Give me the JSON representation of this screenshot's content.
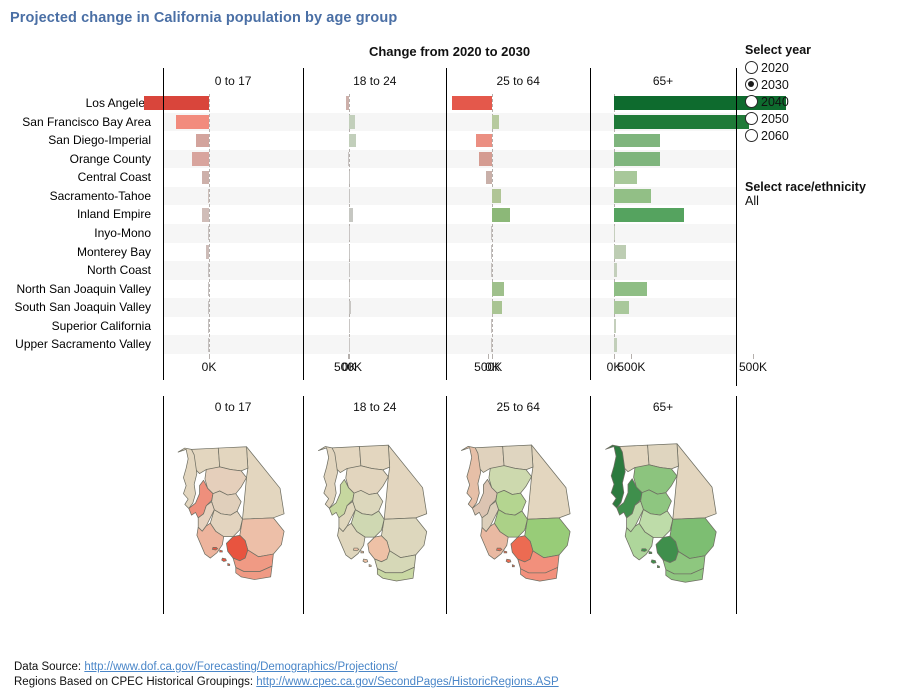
{
  "title": "Projected change in California population by age group",
  "subtitle": "Change from 2020 to 2030",
  "age_groups": [
    "0 to 17",
    "18 to 24",
    "25 to 64",
    "65+"
  ],
  "regions": [
    "Los Angeles",
    "San Francisco Bay Area",
    "San Diego-Imperial",
    "Orange County",
    "Central Coast",
    "Sacramento-Tahoe",
    "Inland Empire",
    "Inyo-Mono",
    "Monterey Bay",
    "North Coast",
    "North San Joaquin Valley",
    "South San Joaquin Valley",
    "Superior California",
    "Upper Sacramento Valley"
  ],
  "axis": {
    "ticks": [
      {
        "value": 0,
        "label": "0K"
      },
      {
        "value": 500000,
        "label": "500K"
      }
    ],
    "min": -250000,
    "max": 640000
  },
  "legend": {
    "year_title": "Select year",
    "years": [
      "2020",
      "2030",
      "2040",
      "2050",
      "2060"
    ],
    "selected_year": "2030",
    "race_title": "Select race/ethnicity",
    "race_value": "All"
  },
  "footer": {
    "line1_label": "Data Source:",
    "line1_link": "http://www.dof.ca.gov/Forecasting/Demographics/Projections/",
    "line2_label": "Regions Based on CPEC Historical Groupings:",
    "line2_link": "http://www.cpec.ca.gov/SecondPages/HistoricRegions.ASP"
  },
  "colors": {
    "title": "#4a6fa5",
    "link": "#4a86c8",
    "stripe": "#f6f6f6",
    "zero_line": "#b5b0ad",
    "neg_strong": "#d9453b",
    "neg_mid": "#f28b7d",
    "neg_weak": "#d9a9a1",
    "neg_faint": "#cdb4b0",
    "pos_strong": "#0e6b2e",
    "pos_dark": "#1f7a38",
    "pos_mid": "#55a35f",
    "pos_soft": "#7fb57d",
    "pos_weak": "#a8c89a",
    "pos_faint": "#c2cfbb",
    "map_neutral": "#e3d6bf",
    "map_outline": "#6f6f63"
  },
  "chart_data": {
    "type": "bar",
    "title": "Change from 2020 to 2030",
    "xlabel": "",
    "ylabel": "",
    "xlim": [
      -250000,
      640000
    ],
    "grid": false,
    "legend_position": "right",
    "categories": [
      "Los Angeles",
      "San Francisco Bay Area",
      "San Diego-Imperial",
      "Orange County",
      "Central Coast",
      "Sacramento-Tahoe",
      "Inland Empire",
      "Inyo-Mono",
      "Monterey Bay",
      "North Coast",
      "North San Joaquin Valley",
      "South San Joaquin Valley",
      "Superior California",
      "Upper Sacramento Valley"
    ],
    "series": [
      {
        "name": "0 to 17",
        "values": [
          -233000,
          -120000,
          -48000,
          -62000,
          -26000,
          -3000,
          -26000,
          -1000,
          -11000,
          -1500,
          -2500,
          -1000,
          -1500,
          -1000
        ],
        "colors": [
          "#d9453b",
          "#f28b7d",
          "#d3a49d",
          "#d8a49d",
          "#cdb0aa",
          "#cfc2bd",
          "#d0bdb8",
          "#c9c2c0",
          "#cdbcb8",
          "#c7c2c1",
          "#c8c3c2",
          "#c6c2c1",
          "#c6c2c1",
          "#c6c2c1"
        ]
      },
      {
        "name": "18 to 24",
        "values": [
          -13000,
          22000,
          23000,
          -1000,
          2000,
          2500,
          12000,
          200,
          1200,
          900,
          4500,
          7500,
          1500,
          600
        ],
        "colors": [
          "#cdb0aa",
          "#c2cfbb",
          "#c2cfbb",
          "#c9c4c3",
          "#c7c5c3",
          "#c7c5c3",
          "#c6c7c2",
          "#c9c5c4",
          "#c8c6c4",
          "#c8c6c4",
          "#c9c6c3",
          "#c8c6c3",
          "#c9c6c4",
          "#c9c6c4"
        ]
      },
      {
        "name": "25 to 64",
        "values": [
          -145000,
          24000,
          -59000,
          -49000,
          -22000,
          31000,
          65000,
          -900,
          -2500,
          -1800,
          42000,
          33000,
          -1500,
          -3500
        ],
        "colors": [
          "#e4584b",
          "#b7ca9f",
          "#eb8f82",
          "#d59c92",
          "#c9b0a9",
          "#b0c596",
          "#8cb878",
          "#c7c3c1",
          "#c6c3c2",
          "#c7c3c1",
          "#9fc08c",
          "#a9c493",
          "#c8c3c1",
          "#c8c3c0"
        ]
      },
      {
        "name": "65+",
        "values": [
          617000,
          485000,
          165000,
          167000,
          82000,
          133000,
          250000,
          3000,
          43000,
          11000,
          118000,
          53000,
          6000,
          10000
        ],
        "colors": [
          "#0e6b2e",
          "#1f7a38",
          "#7fb57d",
          "#7fb57d",
          "#a8c89a",
          "#92bf86",
          "#55a35f",
          "#c6cfbe",
          "#bdcdb3",
          "#c3cfbb",
          "#8fbe85",
          "#a9c89b",
          "#c4cfbc",
          "#c2cfba"
        ]
      }
    ]
  },
  "map_data": {
    "panels": [
      {
        "age_group": "0 to 17",
        "region_fills": {
          "upper_sac": "#e3d6bf",
          "north_coast": "#e3d6bf",
          "superior": "#e3d6bf",
          "sac_tahoe": "#e5cfbb",
          "sf_bay": "#ee8f7c",
          "north_sj": "#e0cfbb",
          "monterey": "#e6d2bf",
          "south_sj": "#e3d4bf",
          "central_coast": "#edb49d",
          "la": "#e8543f",
          "inland": "#edbfa8",
          "orange": "#f09a84",
          "sd_imperial": "#f09a84",
          "inyo": "#e3d6bf"
        }
      },
      {
        "age_group": "18 to 24",
        "region_fills": {
          "upper_sac": "#e3d6bf",
          "north_coast": "#e2d5be",
          "superior": "#e3d6bf",
          "sac_tahoe": "#e2d5be",
          "sf_bay": "#c6d79f",
          "north_sj": "#dcd7bc",
          "monterey": "#e0d7bd",
          "south_sj": "#cfd8b2",
          "central_coast": "#dfd6bd",
          "la": "#eec1a6",
          "inland": "#ddd7bd",
          "orange": "#d6d8b7",
          "sd_imperial": "#c9d8a3",
          "inyo": "#e3d6bf"
        }
      },
      {
        "age_group": "25 to 64",
        "region_fills": {
          "upper_sac": "#e0d2bd",
          "north_coast": "#e6bfa7",
          "superior": "#dfd5c0",
          "sac_tahoe": "#cdd9ae",
          "sf_bay": "#dcc4b2",
          "north_sj": "#b4d590",
          "monterey": "#dccfba",
          "south_sj": "#abd187",
          "central_coast": "#e9b9a2",
          "la": "#ec6b52",
          "inland": "#98cc78",
          "orange": "#f2907c",
          "sd_imperial": "#f2907c",
          "inyo": "#e3d6bf"
        }
      },
      {
        "age_group": "65+",
        "region_fills": {
          "upper_sac": "#e3d6bf",
          "north_coast": "#2c7a3e",
          "superior": "#dfd5bf",
          "sac_tahoe": "#8cc47e",
          "sf_bay": "#3f8f4c",
          "north_sj": "#8ec680",
          "monterey": "#b9d9a6",
          "south_sj": "#bedca9",
          "central_coast": "#aed69b",
          "la": "#3f8f4c",
          "inland": "#7dbe72",
          "orange": "#8ec77f",
          "sd_imperial": "#8ec77f",
          "inyo": "#e3d6bf"
        }
      }
    ]
  }
}
